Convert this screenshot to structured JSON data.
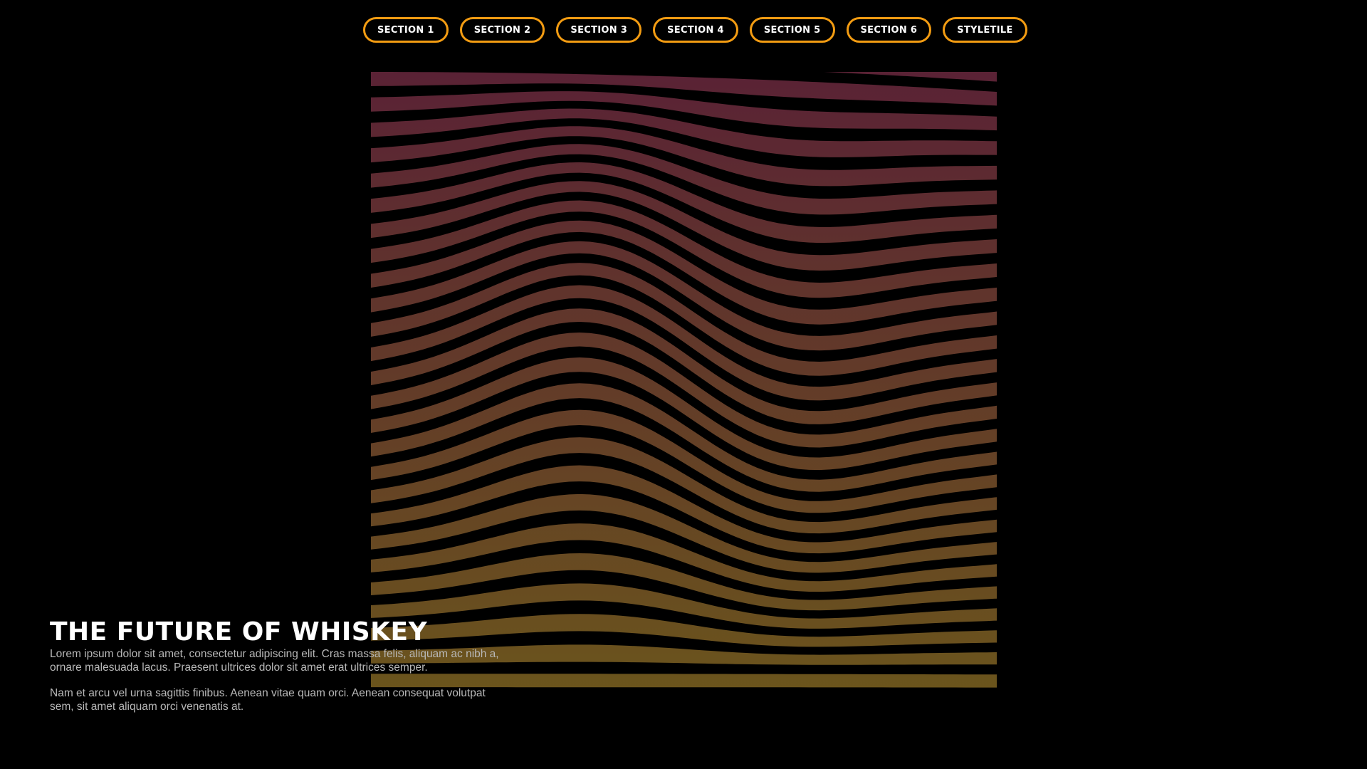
{
  "nav": {
    "items": [
      {
        "label": "SECTION 1"
      },
      {
        "label": "SECTION 2"
      },
      {
        "label": "SECTION 3"
      },
      {
        "label": "SECTION 4"
      },
      {
        "label": "SECTION 5"
      },
      {
        "label": "SECTION 6"
      },
      {
        "label": "STYLETILE"
      }
    ]
  },
  "hero": {
    "title": "THE FUTURE OF WHISKEY",
    "paragraph_1": "Lorem ipsum dolor sit amet, consectetur adipiscing elit. Cras massa felis, aliquam ac nibh a, ornare malesuada lacus. Praesent ultrices dolor sit amet erat ultrices semper.",
    "paragraph_2": "Nam et arcu vel urna sagittis finibus. Aenean vitae quam orci. Aenean consequat volutpat sem, sit amet aliquam orci venenatis at."
  },
  "artwork": {
    "name": "wave-lines-artwork",
    "colors": {
      "top": "#5a2235",
      "bottom": "#6b551c",
      "accent": "#f39c12"
    }
  }
}
